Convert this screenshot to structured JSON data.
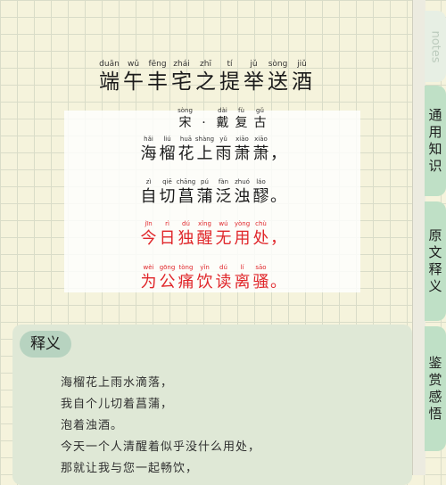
{
  "title": {
    "chars": [
      {
        "py": "duān",
        "hz": "端"
      },
      {
        "py": "wǔ",
        "hz": "午"
      },
      {
        "py": "fēng",
        "hz": "丰"
      },
      {
        "py": "zhái",
        "hz": "宅"
      },
      {
        "py": "zhī",
        "hz": "之"
      },
      {
        "py": "tí",
        "hz": "提"
      },
      {
        "py": "jǔ",
        "hz": "举"
      },
      {
        "py": "sòng",
        "hz": "送"
      },
      {
        "py": "jiǔ",
        "hz": "酒"
      }
    ]
  },
  "author": {
    "chars": [
      {
        "py": "sòng",
        "hz": "宋"
      },
      {
        "py": "",
        "hz": "·"
      },
      {
        "py": "dài",
        "hz": "戴"
      },
      {
        "py": "fù",
        "hz": "复"
      },
      {
        "py": "gǔ",
        "hz": "古"
      }
    ]
  },
  "poem": {
    "lines": [
      {
        "red": false,
        "punct": "，",
        "chars": [
          {
            "py": "hǎi",
            "hz": "海"
          },
          {
            "py": "liú",
            "hz": "榴"
          },
          {
            "py": "huā",
            "hz": "花"
          },
          {
            "py": "shàng",
            "hz": "上"
          },
          {
            "py": "yǔ",
            "hz": "雨"
          },
          {
            "py": "xiāo",
            "hz": "萧"
          },
          {
            "py": "xiāo",
            "hz": "萧"
          }
        ]
      },
      {
        "red": false,
        "punct": "。",
        "chars": [
          {
            "py": "zì",
            "hz": "自"
          },
          {
            "py": "qiē",
            "hz": "切"
          },
          {
            "py": "chāng",
            "hz": "菖"
          },
          {
            "py": "pú",
            "hz": "蒲"
          },
          {
            "py": "fàn",
            "hz": "泛"
          },
          {
            "py": "zhuó",
            "hz": "浊"
          },
          {
            "py": "láo",
            "hz": "醪"
          }
        ]
      },
      {
        "red": true,
        "punct": "，",
        "chars": [
          {
            "py": "jīn",
            "hz": "今"
          },
          {
            "py": "rì",
            "hz": "日"
          },
          {
            "py": "dú",
            "hz": "独"
          },
          {
            "py": "xǐng",
            "hz": "醒"
          },
          {
            "py": "wú",
            "hz": "无"
          },
          {
            "py": "yòng",
            "hz": "用"
          },
          {
            "py": "chù",
            "hz": "处"
          }
        ]
      },
      {
        "red": true,
        "punct": "。",
        "chars": [
          {
            "py": "wèi",
            "hz": "为"
          },
          {
            "py": "gōng",
            "hz": "公"
          },
          {
            "py": "tòng",
            "hz": "痛"
          },
          {
            "py": "yǐn",
            "hz": "饮"
          },
          {
            "py": "dú",
            "hz": "读"
          },
          {
            "py": "lí",
            "hz": "离"
          },
          {
            "py": "sāo",
            "hz": "骚"
          }
        ]
      }
    ]
  },
  "explanation": {
    "tag": "释义",
    "lines": [
      "海榴花上雨水滴落，",
      "我自个儿切着菖蒲，",
      "泡着浊酒。",
      "今天一个人清醒着似乎没什么用处，",
      "那就让我与您一起畅饮，"
    ]
  },
  "tabs": {
    "notes": "notes",
    "usage": "通用知识",
    "translation": "原文释义",
    "appreciation": "鉴赏感悟"
  },
  "colors": {
    "accent_red": "#e0262a",
    "tab_green": "#bfe0c6",
    "card_green": "#dfe8d6"
  }
}
